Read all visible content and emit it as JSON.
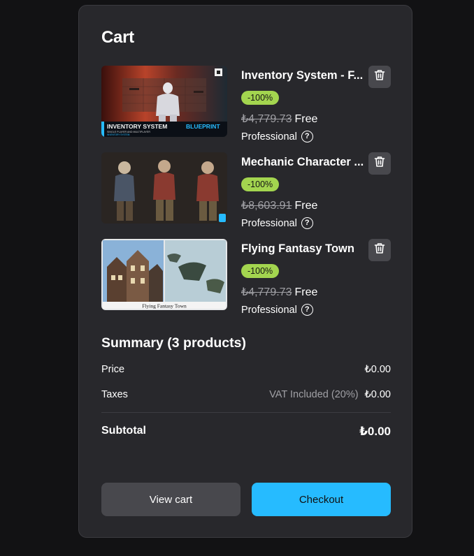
{
  "cart": {
    "title": "Cart"
  },
  "products": [
    {
      "name": "Inventory System - F...",
      "discount": "-100%",
      "old_price": "₺4,779.73",
      "price": "Free",
      "license": "Professional",
      "thumb_text": [
        "INVENTORY SYSTEM",
        "BLUEPRINT",
        "SINGLE PLAYER AND MULTIPLAYER",
        "INVENTORY SYSTEM"
      ]
    },
    {
      "name": "Mechanic Character ...",
      "discount": "-100%",
      "old_price": "₺8,603.91",
      "price": "Free",
      "license": "Professional"
    },
    {
      "name": "Flying Fantasy Town",
      "discount": "-100%",
      "old_price": "₺4,779.73",
      "price": "Free",
      "license": "Professional",
      "thumb_text": [
        "Flying Fantasy Town"
      ]
    }
  ],
  "summary": {
    "title": "Summary (3 products)",
    "price_label": "Price",
    "price_value": "₺0.00",
    "taxes_label": "Taxes",
    "taxes_note": "VAT Included (20%)",
    "taxes_value": "₺0.00",
    "subtotal_label": "Subtotal",
    "subtotal_value": "₺0.00"
  },
  "actions": {
    "view_cart": "View cart",
    "checkout": "Checkout"
  },
  "colors": {
    "panel": "#28282c",
    "badge": "#a3d54f",
    "checkout": "#26bbff",
    "button": "#48484d"
  },
  "icons": {
    "delete": "trash-icon",
    "help": "help-circle-icon"
  }
}
